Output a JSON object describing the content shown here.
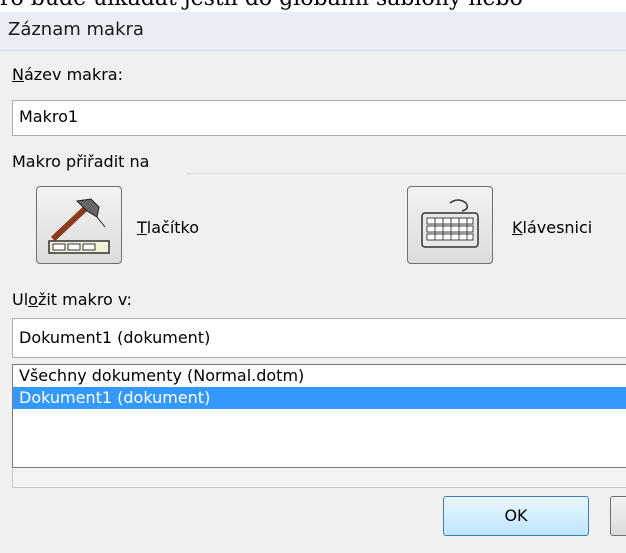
{
  "background_text": "ro bude ulkadat  jestli do globalni sablony nebo",
  "dialog": {
    "title": "Záznam makra",
    "macro_name": {
      "label_prefix": "",
      "label_underlined": "N",
      "label_rest": "ázev makra:",
      "value": "Makro1"
    },
    "assign_group": {
      "label": "Makro přiřadit na"
    },
    "button_option": {
      "label_underlined": "T",
      "label_rest": "lačítko",
      "icon": "hammer-toolbar-icon"
    },
    "keyboard_option": {
      "label_underlined": "K",
      "label_rest": "lávesnici",
      "icon": "keyboard-icon"
    },
    "store_in": {
      "label_prefix": "Ul",
      "label_underlined": "o",
      "label_rest": "žit makro v:",
      "selected_value": "Dokument1 (dokument)",
      "options": [
        "Všechny dokumenty (Normal.dotm)",
        "Dokument1 (dokument)"
      ],
      "selected_index": 1
    },
    "ok_label": "OK"
  },
  "colors": {
    "selection": "#3399ff",
    "ok_border": "#3c7fb1",
    "title_bar": "#e9eef6"
  }
}
